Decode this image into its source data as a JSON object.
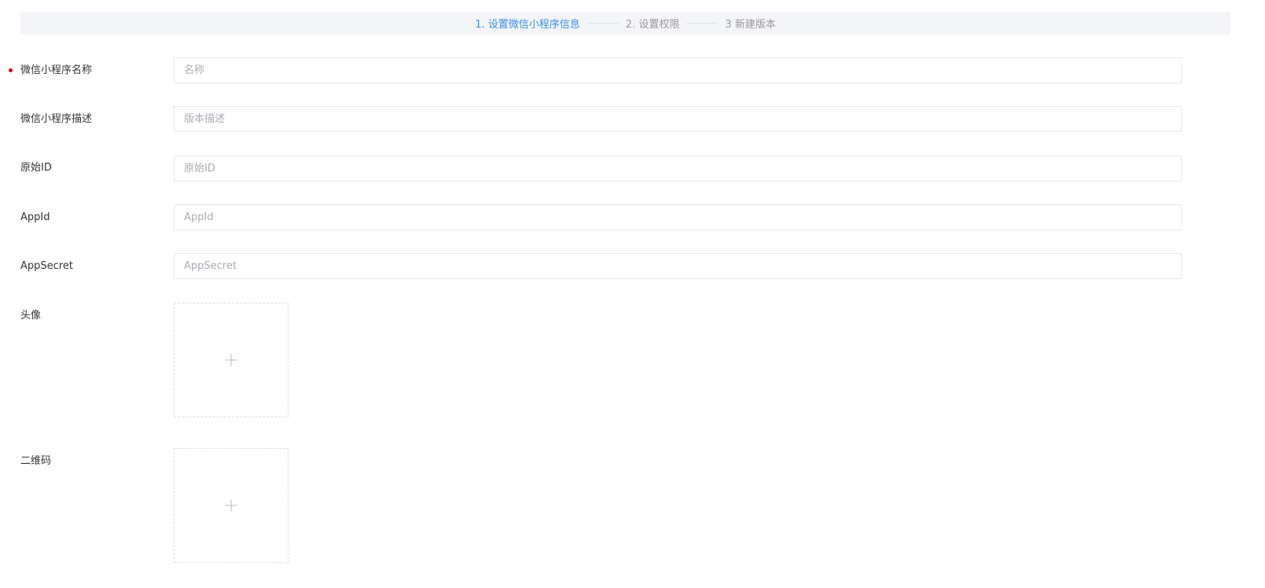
{
  "steps": [
    {
      "label": "1. 设置微信小程序信息",
      "active": true
    },
    {
      "label": "2. 设置权限",
      "active": false
    },
    {
      "label": "3 新建版本",
      "active": false
    }
  ],
  "form": {
    "name": {
      "label": "微信小程序名称",
      "placeholder": "名称",
      "value": "",
      "required": true
    },
    "description": {
      "label": "微信小程序描述",
      "placeholder": "版本描述",
      "value": ""
    },
    "original_id": {
      "label": "原始ID",
      "placeholder": "原始ID",
      "value": ""
    },
    "app_id": {
      "label": "AppId",
      "placeholder": "AppId",
      "value": ""
    },
    "app_secret": {
      "label": "AppSecret",
      "placeholder": "AppSecret",
      "value": ""
    },
    "avatar": {
      "label": "头像",
      "icon": "plus-icon"
    },
    "qrcode": {
      "label": "二维码",
      "icon": "plus-icon"
    }
  },
  "colors": {
    "accent": "#3a8ee6",
    "required": "#d9001b",
    "step_inactive": "#999999",
    "steps_background": "#f4f5f8"
  }
}
